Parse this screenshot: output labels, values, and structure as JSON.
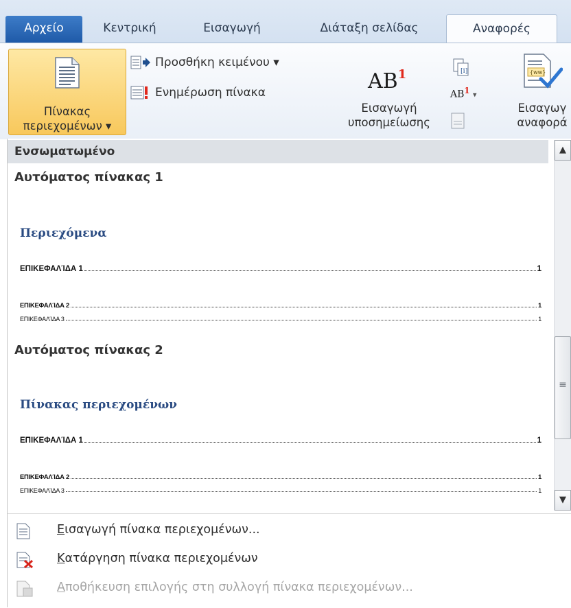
{
  "tabs": {
    "file": "Αρχείο",
    "home": "Κεντρική",
    "insert": "Εισαγωγή",
    "layout": "Διάταξη σελίδας",
    "references": "Αναφορές"
  },
  "ribbon": {
    "toc_button": "Πίνακας\nπεριεχομένων ▾",
    "add_text": "Προσθήκη κειμένου ▾",
    "update_table": "Ενημέρωση πίνακα",
    "insert_footnote": "Εισαγωγή\nυποσημείωσης",
    "insert_citation": "Εισαγωγ\nαναφορά",
    "ab_main": "AB",
    "ab_sup": "1",
    "ab_small": "AB",
    "ab_small_sup": "1",
    "ab_small_arrow": "▾"
  },
  "gallery": {
    "header": "Ενσωματωμένο",
    "items": [
      {
        "title": "Αυτόματος πίνακας 1",
        "heading": "Περιεχόμενα",
        "rows": [
          {
            "label": "ΕΠΙΚΕΦΑΛΊΔΑ 1",
            "page": "1"
          },
          {
            "label": "ΕΠΙΚΕΦΑΛΊΔΑ 2",
            "page": "1"
          },
          {
            "label": "ΕΠΙΚΕΦΑΛΊΔΑ 3",
            "page": "1"
          }
        ]
      },
      {
        "title": "Αυτόματος πίνακας 2",
        "heading": "Πίνακας περιεχομένων",
        "rows": [
          {
            "label": "ΕΠΙΚΕΦΑΛΊΔΑ 1",
            "page": "1"
          },
          {
            "label": "ΕΠΙΚΕΦΑΛΊΔΑ 2",
            "page": "1"
          },
          {
            "label": "ΕΠΙΚΕΦΑΛΊΔΑ 3",
            "page": "1"
          }
        ]
      }
    ],
    "scroll_up": "▲",
    "scroll_down": "▼",
    "scroll_grip": "≡"
  },
  "commands": {
    "insert_toc_first": "Ε",
    "insert_toc_rest": "ισαγωγή πίνακα περιεχομένων...",
    "remove_toc_first": "Κ",
    "remove_toc_rest": "ατάργηση πίνακα περιεχομένων",
    "save_sel_first": "Α",
    "save_sel_rest": "ποθήκευση επιλογής στη συλλογή πίνακα περιεχομένων..."
  },
  "colors": {
    "file_tab": "#1f5aa8",
    "toc_button_active": "#f8c85c",
    "toc_heading": "#2a4b82",
    "footnote_sup": "#e0281c"
  }
}
